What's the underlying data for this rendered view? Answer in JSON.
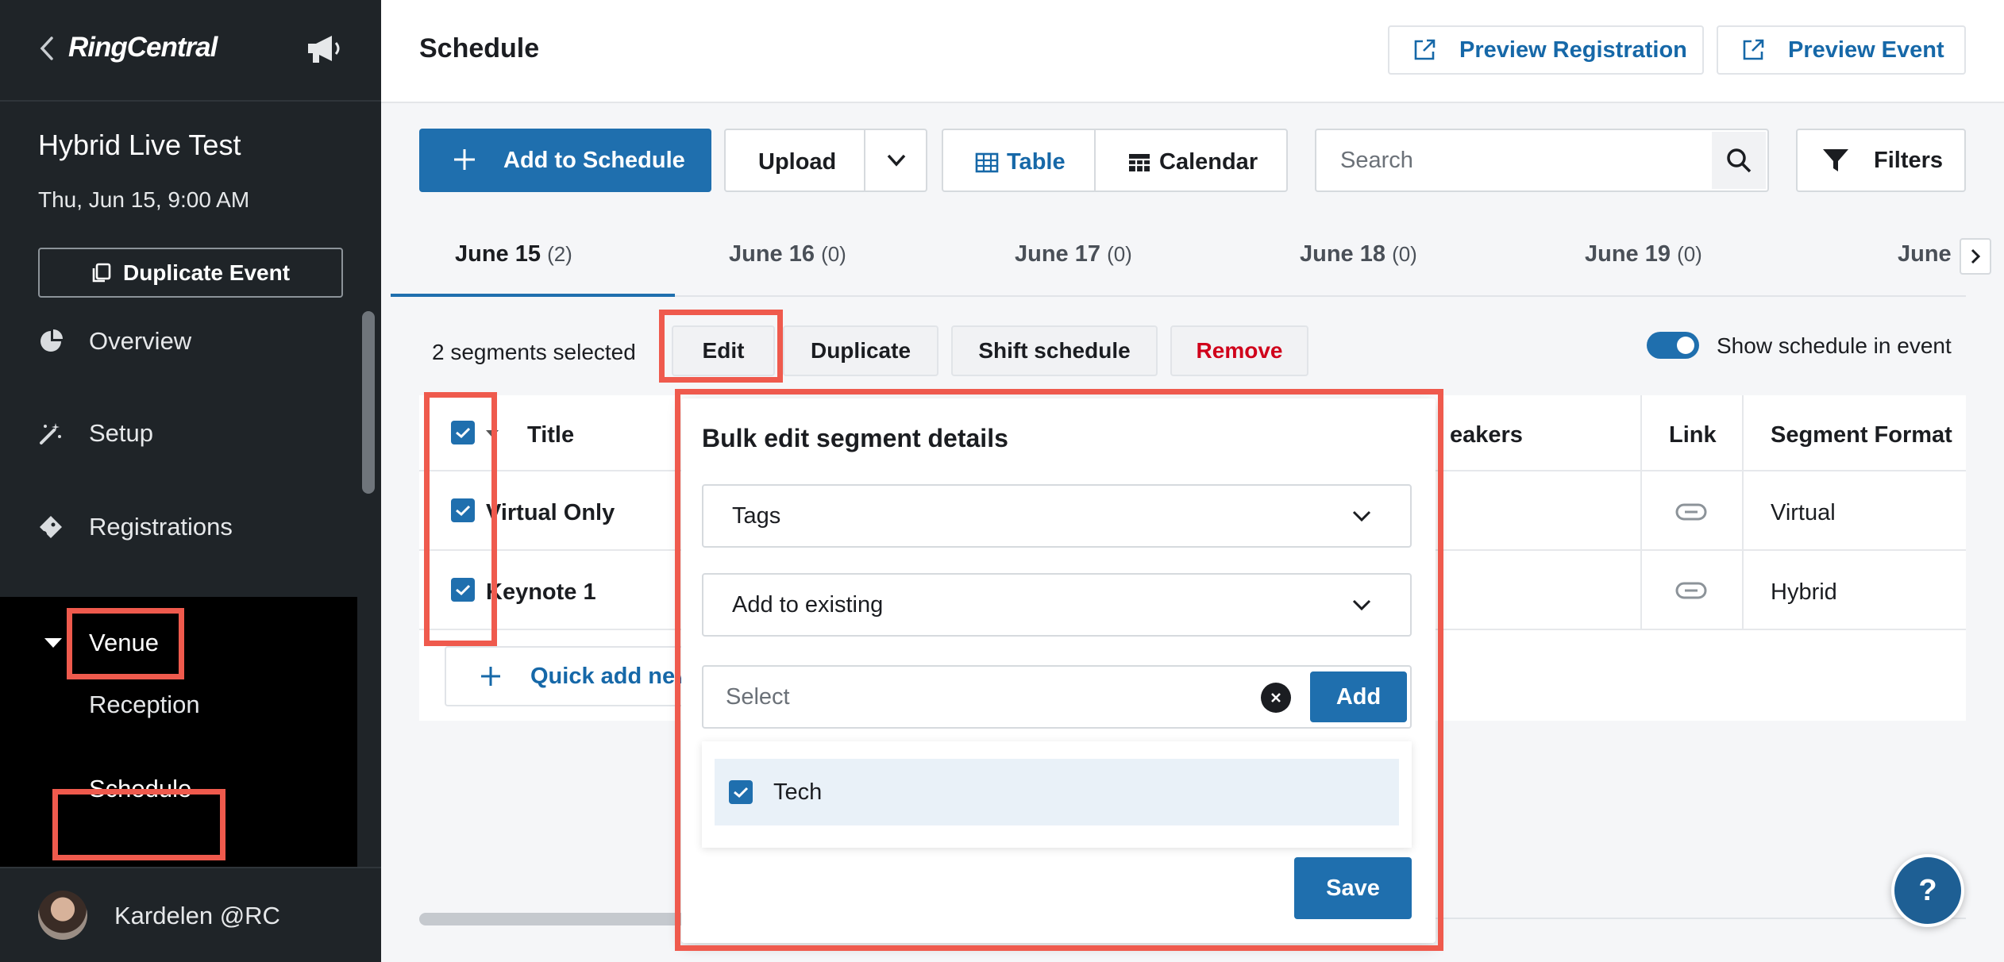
{
  "sidebar": {
    "brand": "RingCentral",
    "event_title": "Hybrid Live Test",
    "event_date": "Thu, Jun 15, 9:00 AM",
    "duplicate_label": "Duplicate Event",
    "nav": [
      {
        "label": "Overview",
        "icon": "pie-chart-icon"
      },
      {
        "label": "Setup",
        "icon": "magic-wand-icon"
      },
      {
        "label": "Registrations",
        "icon": "ticket-icon"
      },
      {
        "label": "Venue",
        "icon": "caret-down-icon"
      }
    ],
    "venue_sub": [
      "Reception",
      "Schedule"
    ],
    "user_name": "Kardelen @RC"
  },
  "header": {
    "title": "Schedule",
    "preview_registration": "Preview Registration",
    "preview_event": "Preview Event"
  },
  "toolbar": {
    "add_label": "Add to Schedule",
    "upload_label": "Upload",
    "view_table": "Table",
    "view_calendar": "Calendar",
    "search_placeholder": "Search",
    "filters_label": "Filters"
  },
  "tabs": [
    {
      "label": "June 15",
      "count": "(2)"
    },
    {
      "label": "June 16",
      "count": "(0)"
    },
    {
      "label": "June 17",
      "count": "(0)"
    },
    {
      "label": "June 18",
      "count": "(0)"
    },
    {
      "label": "June 19",
      "count": "(0)"
    },
    {
      "label": "June",
      "count": ""
    }
  ],
  "bulk": {
    "selected_text": "2 segments selected",
    "edit": "Edit",
    "duplicate": "Duplicate",
    "shift": "Shift schedule",
    "remove": "Remove",
    "show_toggle_label": "Show schedule in event",
    "show_toggle_on": true
  },
  "table": {
    "columns": [
      "Title",
      "eakers",
      "Link",
      "Segment Format"
    ],
    "rows": [
      {
        "title": "Virtual Only",
        "format": "Virtual"
      },
      {
        "title": "Keynote 1",
        "format": "Hybrid"
      }
    ],
    "quick_add": "Quick add new"
  },
  "popover": {
    "title": "Bulk edit segment details",
    "field_select": "Tags",
    "mode_select": "Add to existing",
    "input_placeholder": "Select",
    "add_label": "Add",
    "options": [
      {
        "label": "Tech",
        "checked": true
      }
    ],
    "save_label": "Save"
  },
  "help_label": "?",
  "colors": {
    "accent": "#1f6fae",
    "sidebar_bg": "#1f2428",
    "highlight": "#ef5a4d",
    "remove_text": "#d0021b"
  }
}
